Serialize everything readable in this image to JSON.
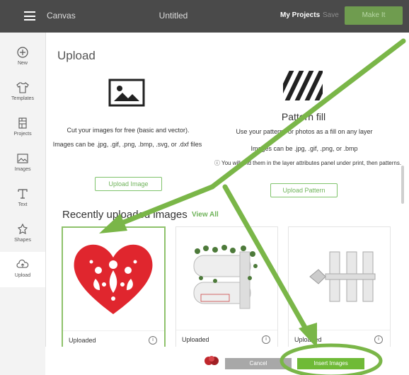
{
  "topbar": {
    "app_title": "Canvas",
    "doc_title": "Untitled",
    "my_projects": "My Projects",
    "save": "Save",
    "make_it": "Make It"
  },
  "sidebar": {
    "items": [
      {
        "label": "New"
      },
      {
        "label": "Templates"
      },
      {
        "label": "Projects"
      },
      {
        "label": "Images"
      },
      {
        "label": "Text"
      },
      {
        "label": "Shapes"
      },
      {
        "label": "Upload"
      }
    ]
  },
  "main": {
    "title": "Upload",
    "upload_image": {
      "line1": "Cut your images for free (basic and vector).",
      "line2": "Images can be .jpg, .gif, .png, .bmp, .svg, or .dxf files",
      "button": "Upload Image"
    },
    "pattern_fill": {
      "title": "Pattern fill",
      "line1": "Use your patterns or photos as a fill on any layer",
      "line2": "Images can be .jpg, .gif, .png, or .bmp",
      "line3": "You will find them in the layer attributes panel under print, then patterns.",
      "button": "Upload Pattern"
    },
    "recent_title": "Recently uploaded images",
    "view_all": "View All",
    "cards": [
      {
        "label": "Uploaded"
      },
      {
        "label": "Uploaded"
      },
      {
        "label": "Uploaded"
      }
    ]
  },
  "footer": {
    "cancel": "Cancel",
    "insert": "Insert Images"
  },
  "colors": {
    "accent_green": "#6fba37",
    "annotation_green": "#7ab648",
    "heart_red": "#e0262e"
  }
}
